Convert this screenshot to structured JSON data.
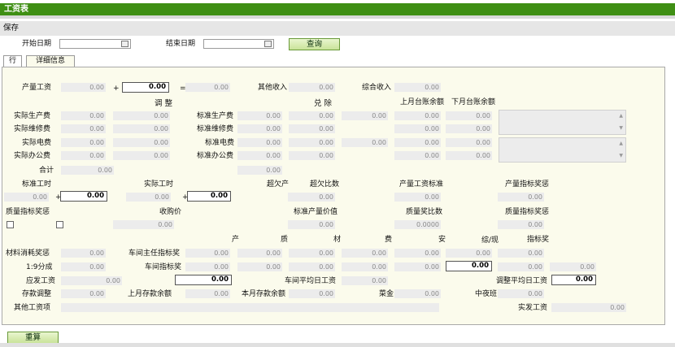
{
  "window": {
    "title": "工资表"
  },
  "toolbar": {
    "save": "保存"
  },
  "filter": {
    "start_label": "开始日期",
    "start_value": "",
    "end_label": "结束日期",
    "end_value": "",
    "query": "查询"
  },
  "tabs": [
    "行",
    "详细信息"
  ],
  "r1": {
    "l1": "产量工资",
    "v1": "0.00",
    "plus": "+",
    "e1": "0.00",
    "eq": "=",
    "v2": "0.00",
    "l2": "其他收入",
    "v3": "0.00",
    "l3": "综合收入",
    "v4": "0.00"
  },
  "hdr": {
    "adjust": "调 整",
    "exchange": "兑 除",
    "last_balance": "上月台账余额",
    "next_balance": "下月台账余额"
  },
  "rows": [
    {
      "l": "实际生产费",
      "a": "0.00",
      "b": "0.00",
      "s": "标准生产费",
      "c": "0.00",
      "d": "0.00",
      "e": "0.00",
      "f": "0.00",
      "g": "0.00"
    },
    {
      "l": "实际维修费",
      "a": "0.00",
      "b": "0.00",
      "s": "标准维修费",
      "c": "0.00",
      "d": "0.00",
      "e": "",
      "f": "0.00",
      "g": "0.00"
    },
    {
      "l": "实际电费",
      "a": "0.00",
      "b": "0.00",
      "s": "标准电费",
      "c": "0.00",
      "d": "0.00",
      "e": "0.00",
      "f": "0.00",
      "g": "0.00"
    },
    {
      "l": "实际办公费",
      "a": "0.00",
      "b": "0.00",
      "s": "标准办公费",
      "c": "0.00",
      "d": "0.00",
      "e": "",
      "f": "0.00",
      "g": "0.00"
    }
  ],
  "total": {
    "l": "合计",
    "v": "0.00",
    "v2": "0.00"
  },
  "std": {
    "l1": "标准工时",
    "l2": "实际工时",
    "l3": "超欠产",
    "l4": "超欠比数",
    "l5": "产量工资标准",
    "l6": "产量指标奖惩",
    "v1": "0.00",
    "plus": "+",
    "e1": "0.00",
    "v2": "0.00",
    "e2": "0.00",
    "v3": "0.00",
    "v4": "0.00",
    "v5": "0.00"
  },
  "qual": {
    "l1": "质量指标奖惩",
    "l2": "收购价",
    "l3": "标准产量价值",
    "l4": "质量奖比数",
    "l5": "质量指标奖惩",
    "v1": "0.00",
    "v2": "0.00",
    "v3": "0.0000",
    "v4": "0.00"
  },
  "prod": {
    "h1": "产",
    "h2": "质",
    "h3": "材",
    "h4": "费",
    "h5": "安",
    "h6": "综/现",
    "h7": "指标奖"
  },
  "mat": {
    "l1": "材料消耗奖惩",
    "v1": "0.00",
    "l2": "车间主任指标奖",
    "cells": [
      "0.00",
      "0.00",
      "0.00",
      "0.00",
      "0.00",
      "0.00",
      "0.00"
    ]
  },
  "split": {
    "l1": "1:9分成",
    "v1": "0.00",
    "l2": "车间指标奖",
    "cells": [
      "0.00",
      "0.00",
      "0.00",
      "0.00",
      "0.00"
    ],
    "e1": "0.00",
    "v7": "0.00",
    "v8": "0.00"
  },
  "pay": {
    "l1": "应发工资",
    "v1": "0.00",
    "e1": "0.00",
    "l2": "车间平均日工资",
    "v2": "0.00",
    "l3": "调整平均日工资",
    "e2": "0.00"
  },
  "dep": {
    "l1": "存款调整",
    "v1": "0.00",
    "l2": "上月存款余额",
    "v2": "0.00",
    "l3": "本月存款余额",
    "v3": "0.00",
    "l4": "菜金",
    "v4": "0.00",
    "l5": "中夜班",
    "v5": "0.00"
  },
  "other": {
    "l1": "其他工资项",
    "l2": "实发工资",
    "v2": "0.00"
  },
  "recalc": "重算"
}
